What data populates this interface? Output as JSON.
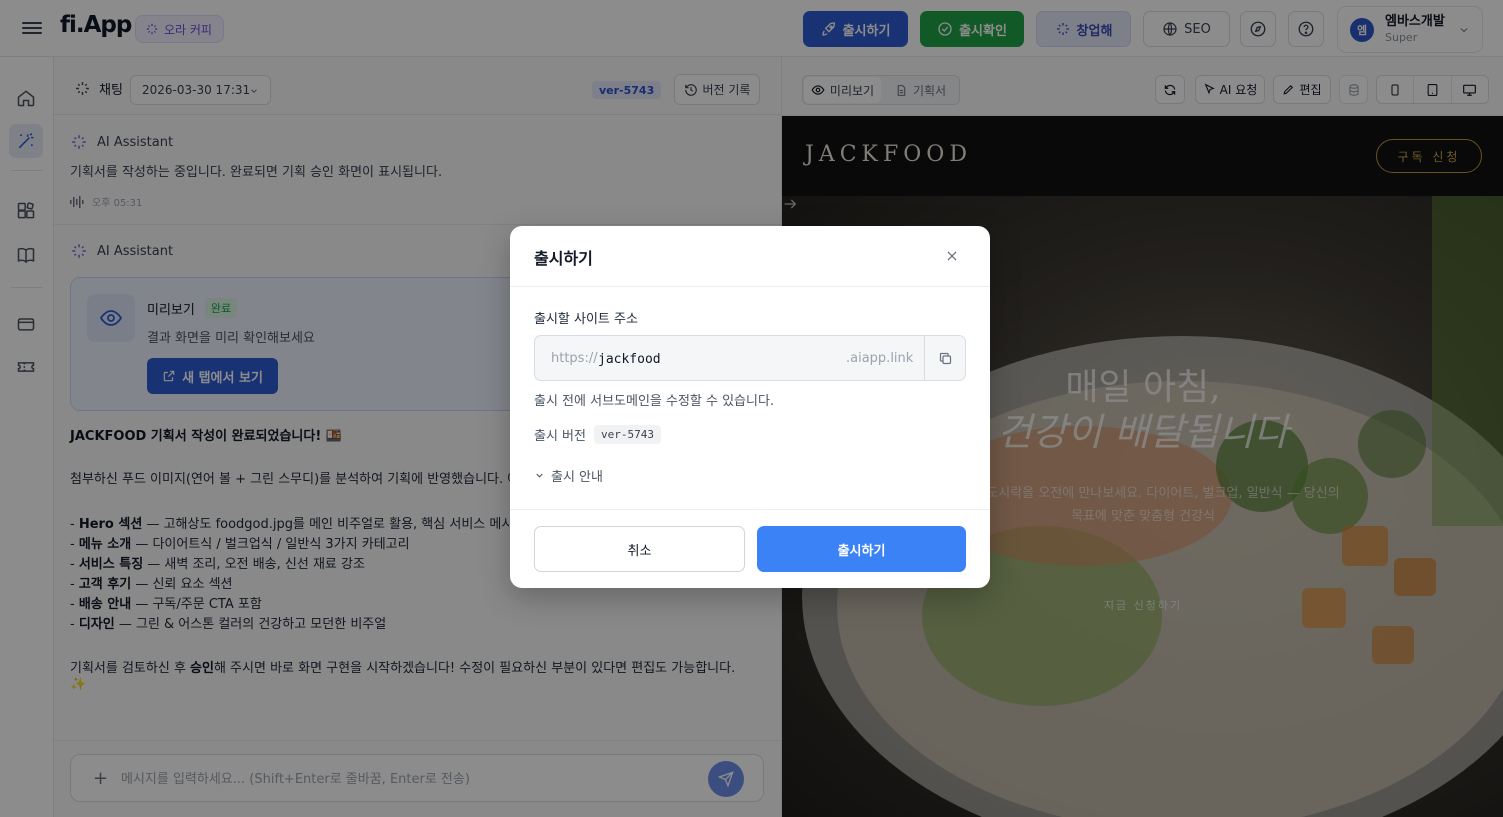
{
  "topbar": {
    "logo": "fi.App",
    "workspace": "오라 커피",
    "publish_label": "출시하기",
    "confirm_label": "출시확인",
    "startup_label": "창업해",
    "seo_label": "SEO",
    "user": {
      "avatar": "엠",
      "name": "엠바스개발",
      "role": "Super"
    }
  },
  "chat": {
    "title": "채팅",
    "date": "2026-03-30 17:31",
    "version": "ver-5743",
    "history_label": "버전 기록",
    "messages": [
      {
        "author": "AI Assistant",
        "text": "기획서를 작성하는 중입니다. 완료되면 기획 승인 화면이 표시됩니다.",
        "time": "오후 05:31"
      },
      {
        "author": "AI Assistant",
        "card": {
          "title": "미리보기",
          "badge": "완료",
          "desc": "결과 화면을 미리 확인해보세요",
          "button": "새 탭에서 보기"
        },
        "headline": "JACKFOOD 기획서 작성이 완료되었습니다! 🍱",
        "intro": "첨부하신 푸드 이미지(연어 볼 + 그린 스무디)를 분석하여 기획에 반영했습니다. 아",
        "bullets": [
          {
            "key": "Hero 섹션",
            "text": " — 고해상도 foodgod.jpg를 메인 비주얼로 활용, 핵심 서비스 메시지"
          },
          {
            "key": "메뉴 소개",
            "text": " — 다이어트식 / 벌크업식 / 일반식 3가지 카테고리"
          },
          {
            "key": "서비스 특징",
            "text": " — 새벽 조리, 오전 배송, 신선 재료 강조"
          },
          {
            "key": "고객 후기",
            "text": " — 신뢰 요소 섹션"
          },
          {
            "key": "배송 안내",
            "text": " — 구독/주문 CTA 포함"
          },
          {
            "key": "디자인",
            "text": " — 그린 & 어스톤 컬러의 건강하고 모던한 비주얼"
          }
        ],
        "closing_pre": "기획서를 검토하신 후 ",
        "closing_bold": "승인",
        "closing_post": "해 주시면 바로 화면 구현을 시작하겠습니다! 수정이 필요하신 부분이 있다면 편집도 가능합니다.",
        "closing_emoji": "✨"
      }
    ],
    "input_placeholder": "메시지를 입력하세요... (Shift+Enter로 줄바꿈, Enter로 전송)"
  },
  "preview_panel": {
    "tab_preview": "미리보기",
    "tab_plan": "기획서",
    "ai_request_label": "AI 요청",
    "edit_label": "편집",
    "site": {
      "brand": "JACKFOOD",
      "subscribe": "구독 신청",
      "hero_line1": "매일 아침,",
      "hero_line2": "건강이 배달됩니다",
      "hero_sub1": "신선한 도시락을 오전에 만나보세요. 다이어트, 벌크업, 일반식 — 당신의",
      "hero_sub2": "목표에 맞춘 맞춤형 건강식",
      "cta": "지금 신청하기"
    }
  },
  "modal": {
    "title": "출시하기",
    "field_label": "출시할 사이트 주소",
    "url_prefix": "https://",
    "subdomain": "jackfood",
    "url_suffix": ".aiapp.link",
    "help": "출시 전에 서브도메인을 수정할 수 있습니다.",
    "version_label": "출시 버전",
    "version": "ver-5743",
    "guide_label": "출시 안내",
    "cancel_label": "취소",
    "publish_label": "출시하기"
  },
  "colors": {
    "primary": "#2d5bd3",
    "success": "#22a34a",
    "publish_button": "#3b82f6",
    "gold": "#c9a64d"
  }
}
